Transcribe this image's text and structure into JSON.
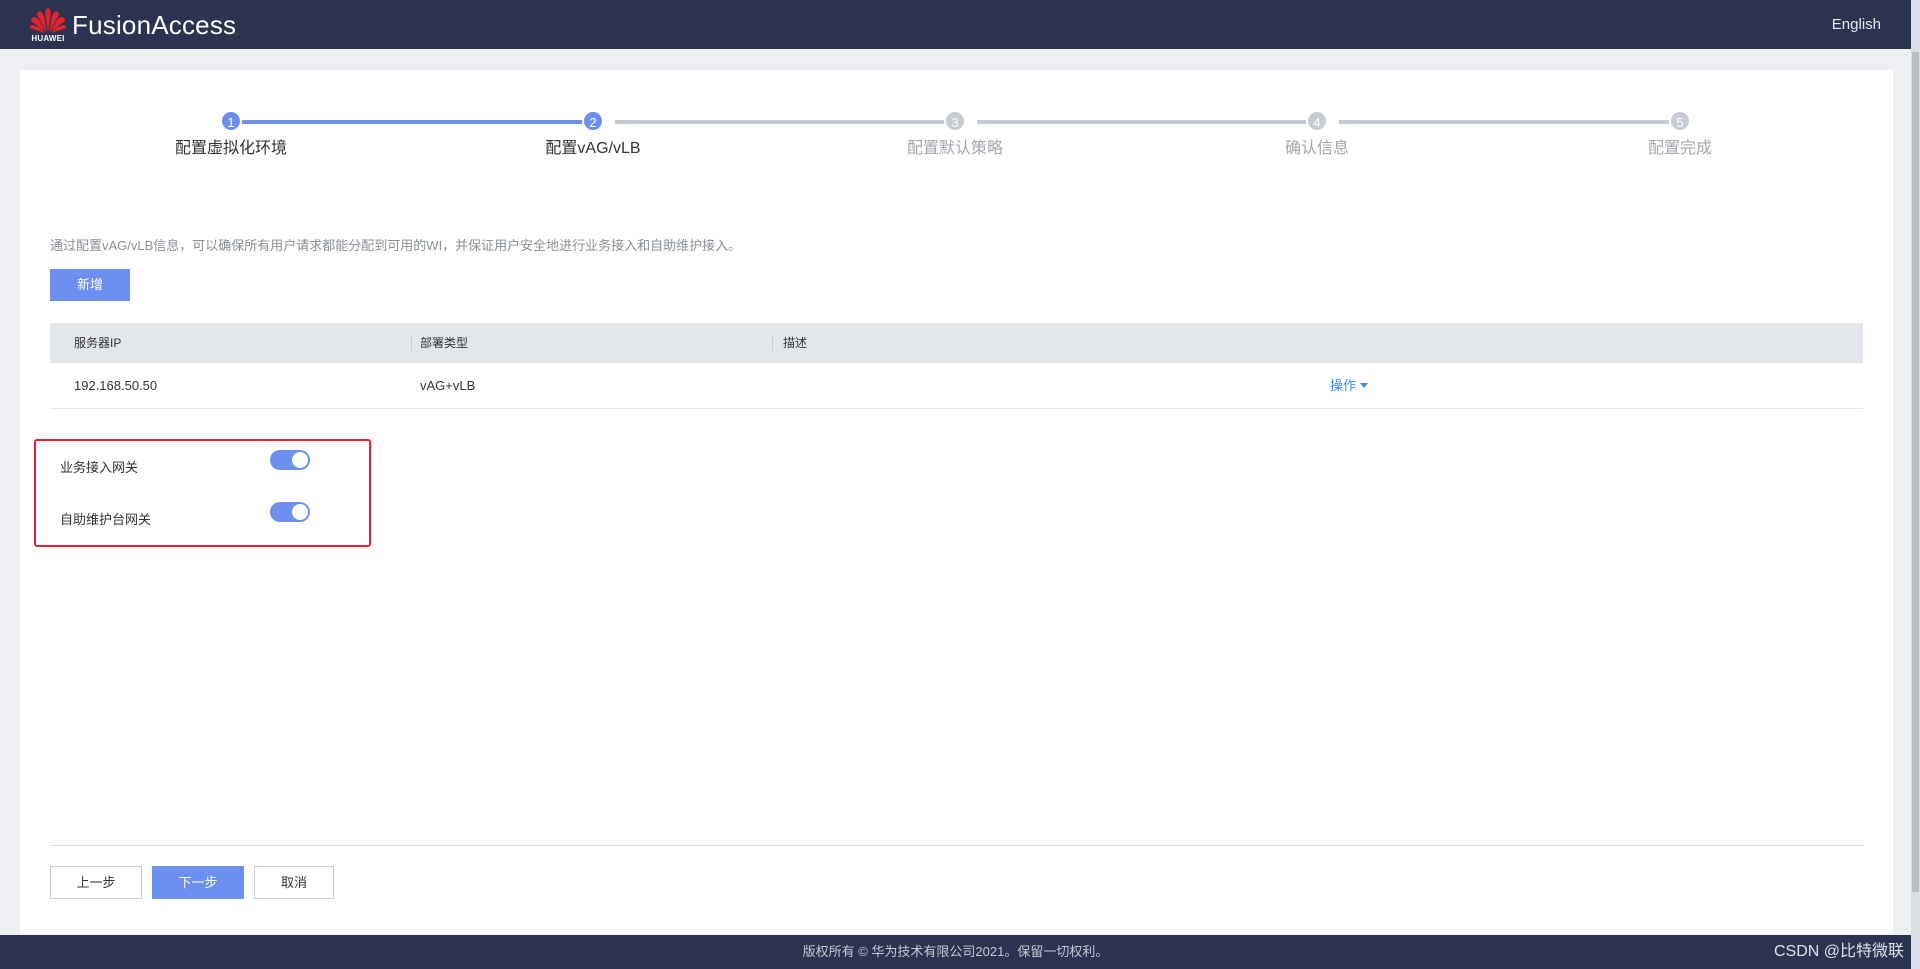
{
  "header": {
    "brand": "HUAWEI",
    "app_title": "FusionAccess",
    "language_link": "English"
  },
  "stepper": {
    "steps": [
      {
        "number": "1",
        "label": "配置虚拟化环境",
        "state": "done"
      },
      {
        "number": "2",
        "label": "配置vAG/vLB",
        "state": "current"
      },
      {
        "number": "3",
        "label": "配置默认策略",
        "state": "pending"
      },
      {
        "number": "4",
        "label": "确认信息",
        "state": "pending"
      },
      {
        "number": "5",
        "label": "配置完成",
        "state": "pending"
      }
    ]
  },
  "main": {
    "description": "通过配置vAG/vLB信息，可以确保所有用户请求都能分配到可用的WI，并保证用户安全地进行业务接入和自助维护接入。",
    "add_button": "新增",
    "table": {
      "columns": [
        "服务器IP",
        "部署类型",
        "描述"
      ],
      "rows": [
        {
          "server_ip": "192.168.50.50",
          "deploy_type": "vAG+vLB",
          "description": "",
          "action": "操作"
        }
      ]
    },
    "switches": [
      {
        "label": "业务接入网关",
        "enabled": true
      },
      {
        "label": "自助维护台网关",
        "enabled": true
      }
    ]
  },
  "actions": {
    "prev": "上一步",
    "next": "下一步",
    "cancel": "取消"
  },
  "footer": {
    "copyright": "版权所有 © 华为技术有限公司2021。保留一切权利。",
    "watermark": "CSDN @比特微联"
  },
  "colors": {
    "header_bg": "#2b3350",
    "accent": "#6d8ff0",
    "link": "#3d87f0",
    "highlight_border": "#e8222a"
  }
}
